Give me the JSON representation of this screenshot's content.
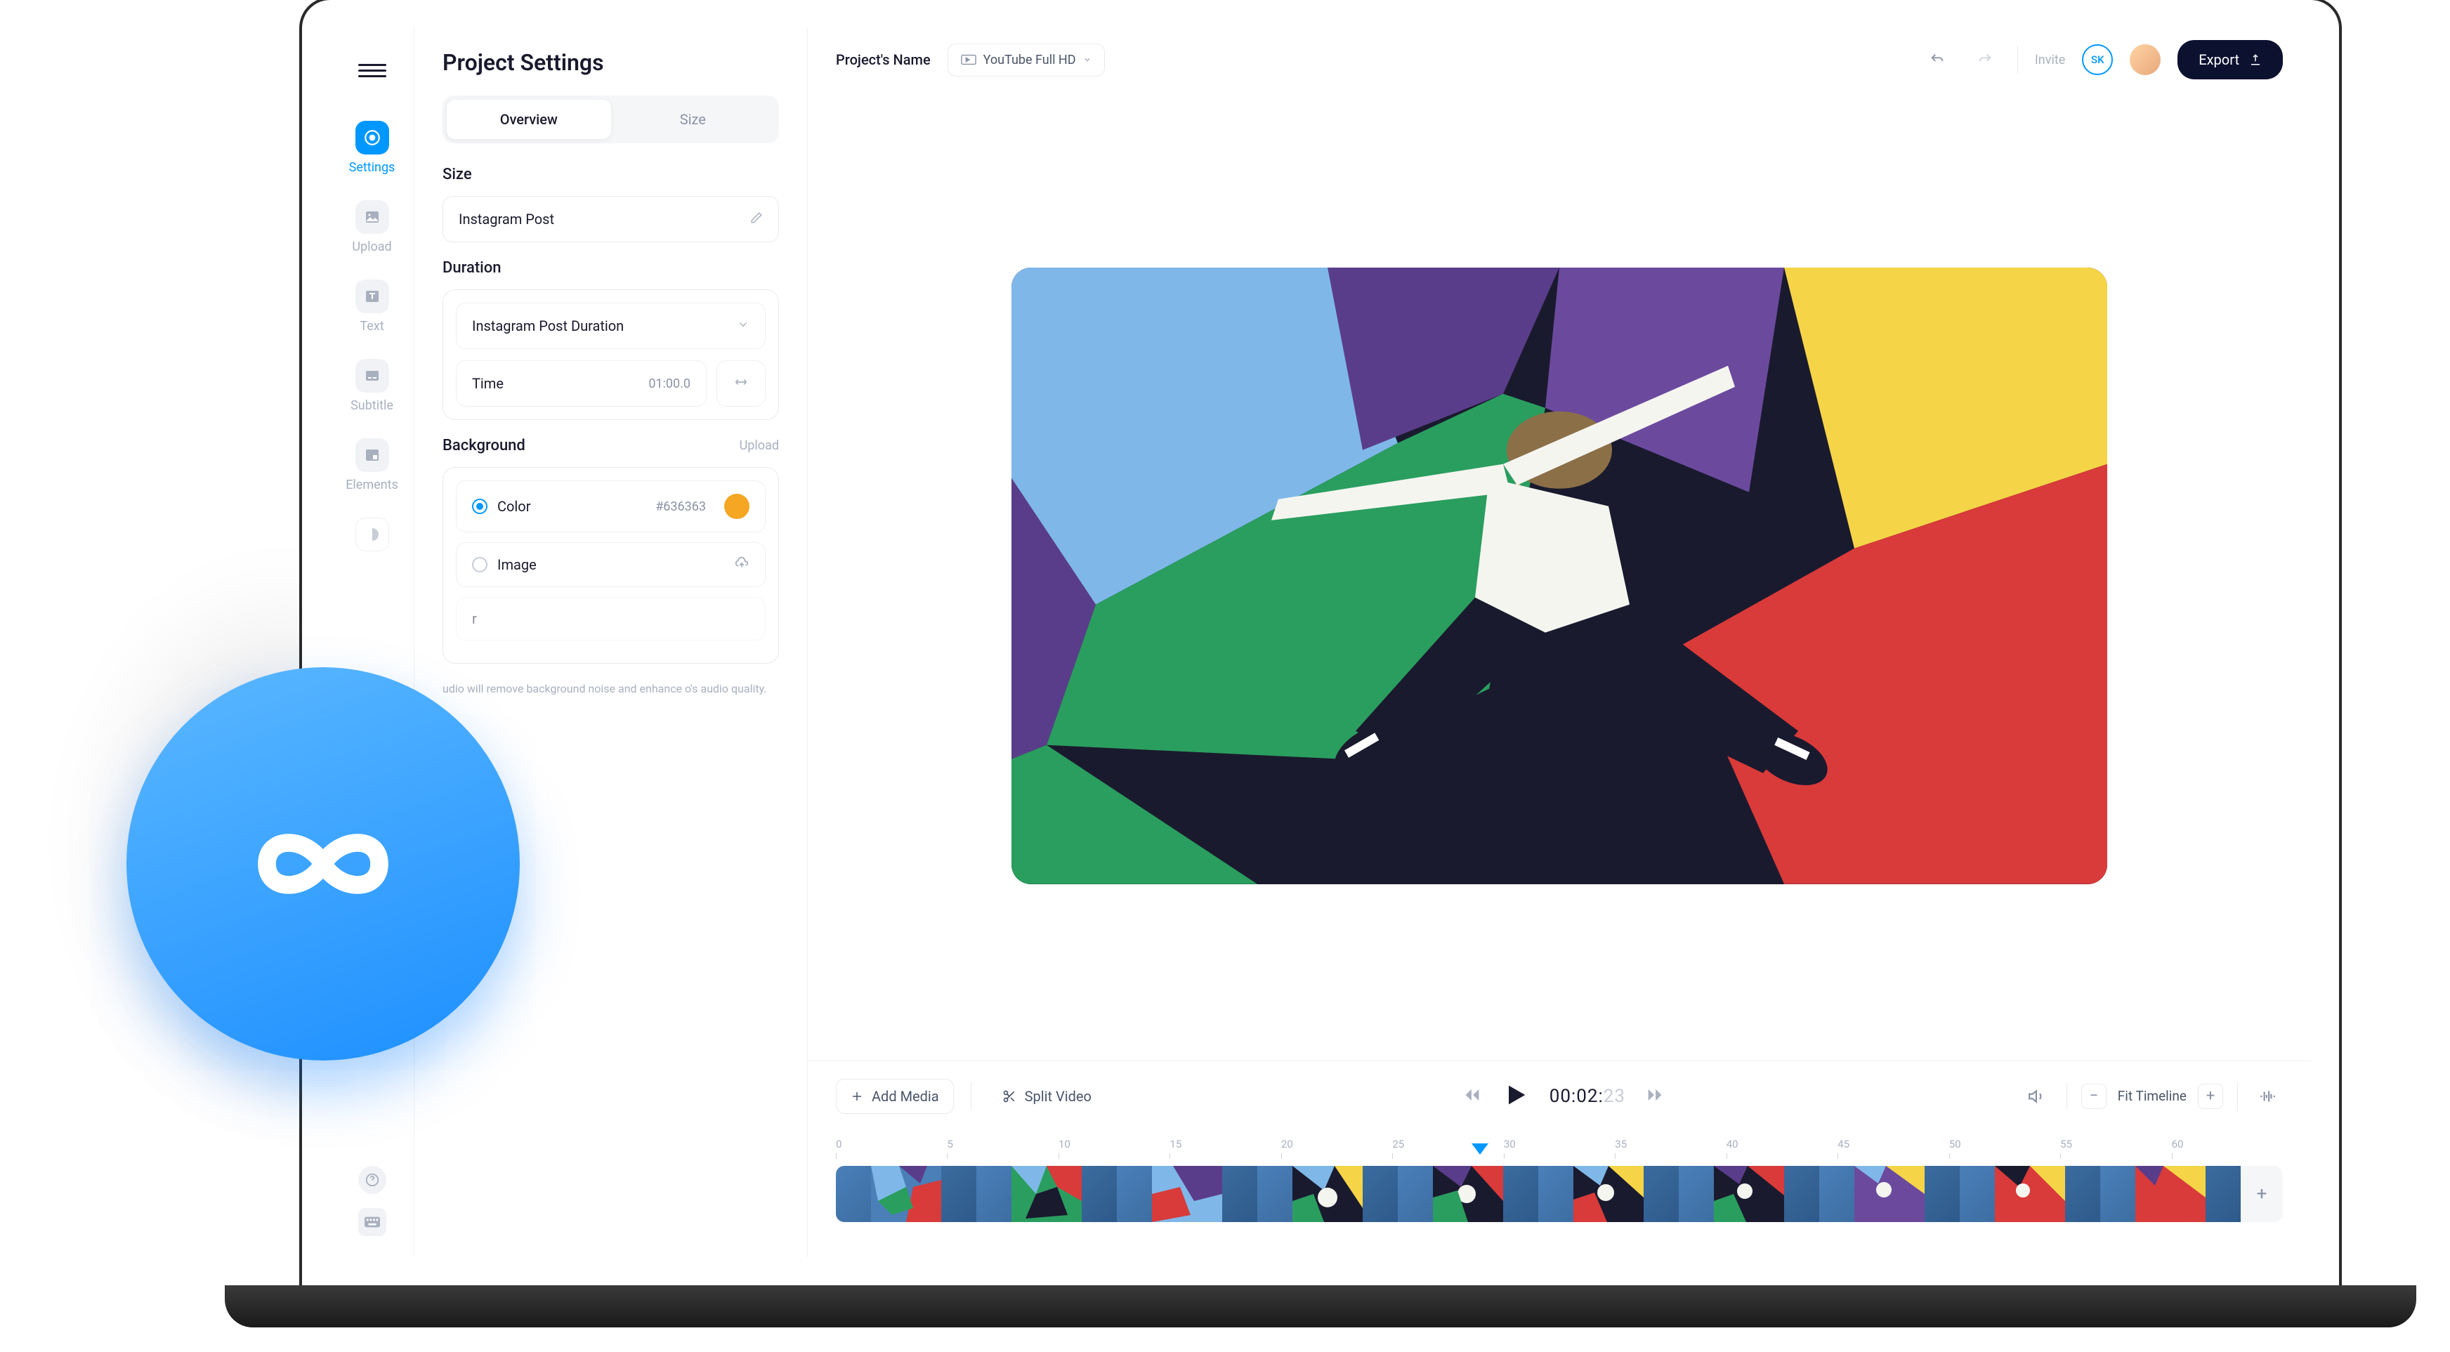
{
  "sidebar": {
    "items": [
      {
        "label": "Settings"
      },
      {
        "label": "Upload"
      },
      {
        "label": "Text"
      },
      {
        "label": "Subtitle"
      },
      {
        "label": "Elements"
      }
    ]
  },
  "panel": {
    "title": "Project Settings",
    "tabs": {
      "overview": "Overview",
      "size": "Size"
    },
    "size": {
      "label": "Size",
      "value": "Instagram Post"
    },
    "duration": {
      "label": "Duration",
      "preset": "Instagram Post Duration",
      "time_label": "Time",
      "time_value": "01:00.0"
    },
    "background": {
      "label": "Background",
      "action": "Upload",
      "color_label": "Color",
      "color_hex": "#636363",
      "image_label": "Image"
    },
    "audio_help": "udio will remove background noise and enhance o's audio quality."
  },
  "header": {
    "project_name": "Project's Name",
    "preset": "YouTube Full HD",
    "invite": "Invite",
    "user_initials": "SK",
    "export": "Export"
  },
  "controls": {
    "add_media": "Add Media",
    "split_video": "Split Video",
    "timecode_main": "00:02:",
    "timecode_frames": "23",
    "fit": "Fit Timeline"
  },
  "timeline": {
    "ticks": [
      "0",
      "5",
      "10",
      "15",
      "20",
      "25",
      "30",
      "35",
      "40",
      "45",
      "50",
      "55",
      "60"
    ]
  }
}
